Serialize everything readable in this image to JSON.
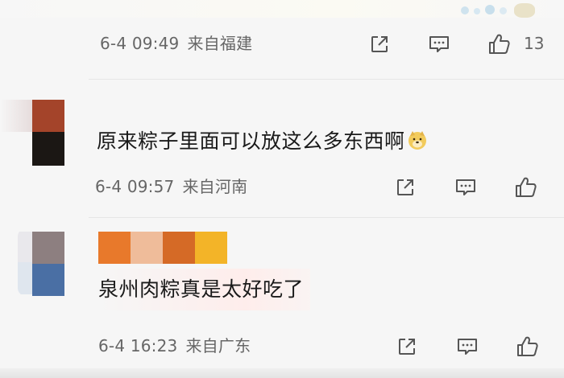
{
  "comments": [
    {
      "date": "6-4 09:49",
      "location": "来自福建",
      "likes": "13"
    },
    {
      "text": "原来粽子里面可以放这么多东西啊",
      "emoji": "doge-emoji",
      "date": "6-4 09:57",
      "location": "来自河南",
      "likes": ""
    },
    {
      "text": "泉州肉粽真是太好吃了",
      "date": "6-4 16:23",
      "location": "来自广东",
      "likes": ""
    }
  ],
  "icons": {
    "share": "share-icon",
    "comment": "comment-icon",
    "like": "thumbs-up-icon"
  },
  "colors": {
    "meta_text": "#666666",
    "comment_text": "#1a1a1a",
    "background": "#f6f6f6"
  }
}
